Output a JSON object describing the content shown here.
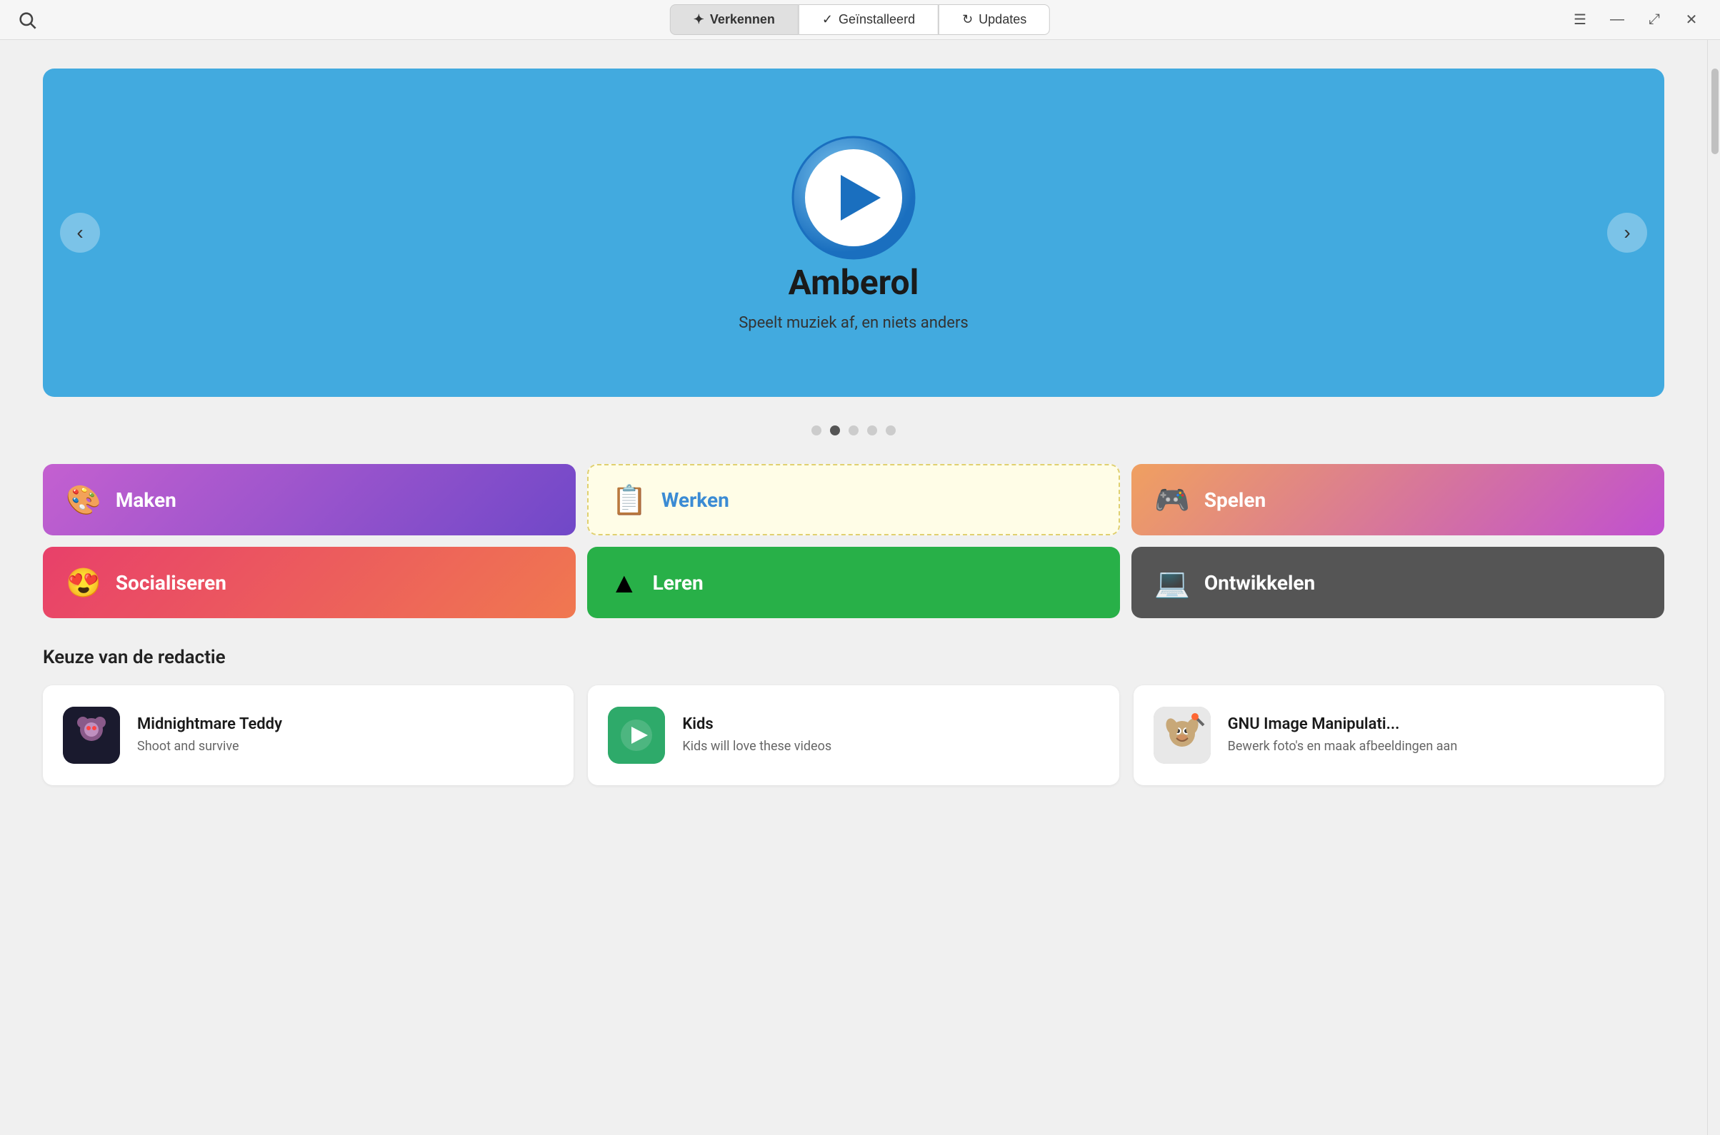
{
  "titlebar": {
    "search_icon": "search-icon",
    "tabs": [
      {
        "id": "verkennen",
        "label": "Verkennen",
        "active": true,
        "icon": "sparkle"
      },
      {
        "id": "geinstalleerd",
        "label": "Geïnstalleerd",
        "active": false,
        "icon": "checkmark"
      },
      {
        "id": "updates",
        "label": "Updates",
        "active": false,
        "icon": "refresh"
      }
    ],
    "controls": {
      "menu": "☰",
      "minimize": "—",
      "maximize": "⤢",
      "close": "✕"
    }
  },
  "carousel": {
    "title": "Amberol",
    "subtitle": "Speelt muziek af, en niets anders",
    "prev_label": "‹",
    "next_label": "›",
    "dots": [
      {
        "index": 0,
        "active": false
      },
      {
        "index": 1,
        "active": true
      },
      {
        "index": 2,
        "active": false
      },
      {
        "index": 3,
        "active": false
      },
      {
        "index": 4,
        "active": false
      }
    ]
  },
  "categories": [
    {
      "id": "maken",
      "label": "Maken",
      "emoji": "🎨",
      "style": "maken"
    },
    {
      "id": "werken",
      "label": "Werken",
      "emoji": "📋",
      "style": "werken"
    },
    {
      "id": "spelen",
      "label": "Spelen",
      "emoji": "🎮",
      "style": "spelen"
    },
    {
      "id": "socialiseren",
      "label": "Socialiseren",
      "emoji": "😍",
      "style": "socialiseren"
    },
    {
      "id": "leren",
      "label": "Leren",
      "emoji": "▲",
      "style": "leren"
    },
    {
      "id": "ontwikkelen",
      "label": "Ontwikkelen",
      "emoji": "💻",
      "style": "ontwikkelen"
    }
  ],
  "editorial": {
    "section_title": "Keuze van de redactie",
    "apps": [
      {
        "id": "midnightmare",
        "name": "Midnightmare Teddy",
        "desc": "Shoot and survive",
        "icon_style": "midnightmare"
      },
      {
        "id": "kids",
        "name": "Kids",
        "desc": "Kids will love these videos",
        "icon_style": "kids"
      },
      {
        "id": "gimp",
        "name": "GNU Image Manipulati...",
        "desc": "Bewerk foto's en maak afbeeldingen aan",
        "icon_style": "gimp"
      }
    ]
  }
}
